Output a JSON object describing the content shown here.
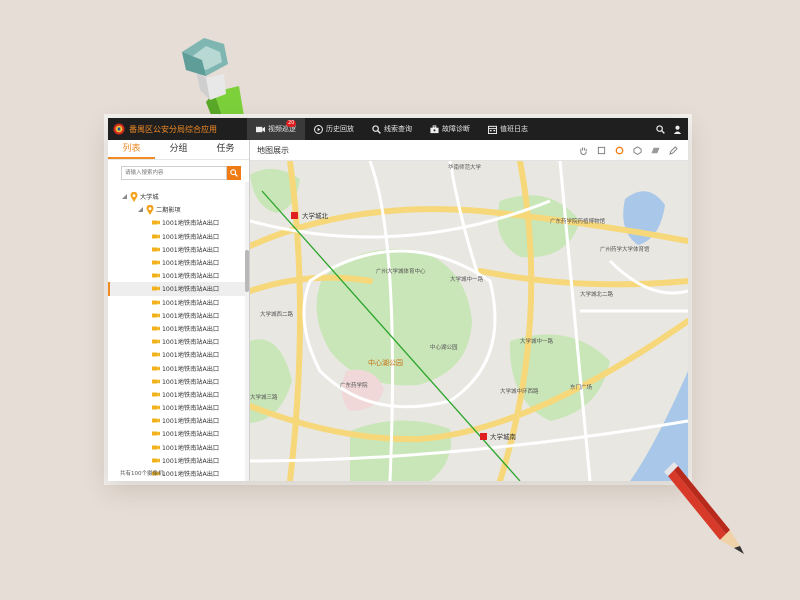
{
  "app": {
    "title": "番禺区公安分局综合应用"
  },
  "nav": [
    {
      "label": "视频巡逻",
      "icon": "video-icon",
      "badge": "20"
    },
    {
      "label": "历史回放",
      "icon": "play-icon"
    },
    {
      "label": "线索查询",
      "icon": "search-icon"
    },
    {
      "label": "故障诊断",
      "icon": "toolbox-icon"
    },
    {
      "label": "值班日志",
      "icon": "calendar-icon"
    }
  ],
  "sidebar": {
    "tabs": [
      "列表",
      "分组",
      "任务"
    ],
    "search_placeholder": "请输入搜索内容",
    "tree_root": "大学城",
    "tree_group": "二期影项",
    "camera_label": "1001地铁南站A出口",
    "footer": "共有100个摄像机"
  },
  "map": {
    "title": "地图展示",
    "labels": {
      "daxuecheng_north": "大学城北",
      "daxuecheng_south": "大学城南",
      "central_lake_park": "中心湖公园",
      "zhongxinhu": "中心湖公园",
      "sports": "广州大学城体育中心",
      "gdut": "广东药学院药植博物馆",
      "gzhu": "广州药学大学体育馆",
      "gdpu": "广东药学院",
      "huanan": "华南师范大学",
      "dongmen": "东门广场",
      "n_ring": "大学城北二路",
      "w_ring": "大学城西二路",
      "s_ring": "大学城三路",
      "center_rd": "大学城中一路",
      "e_ring": "大学城中一路",
      "s_ring2": "大学城中环西路"
    }
  },
  "colors": {
    "accent": "#f08a24",
    "topbar": "#1f1f1f"
  }
}
